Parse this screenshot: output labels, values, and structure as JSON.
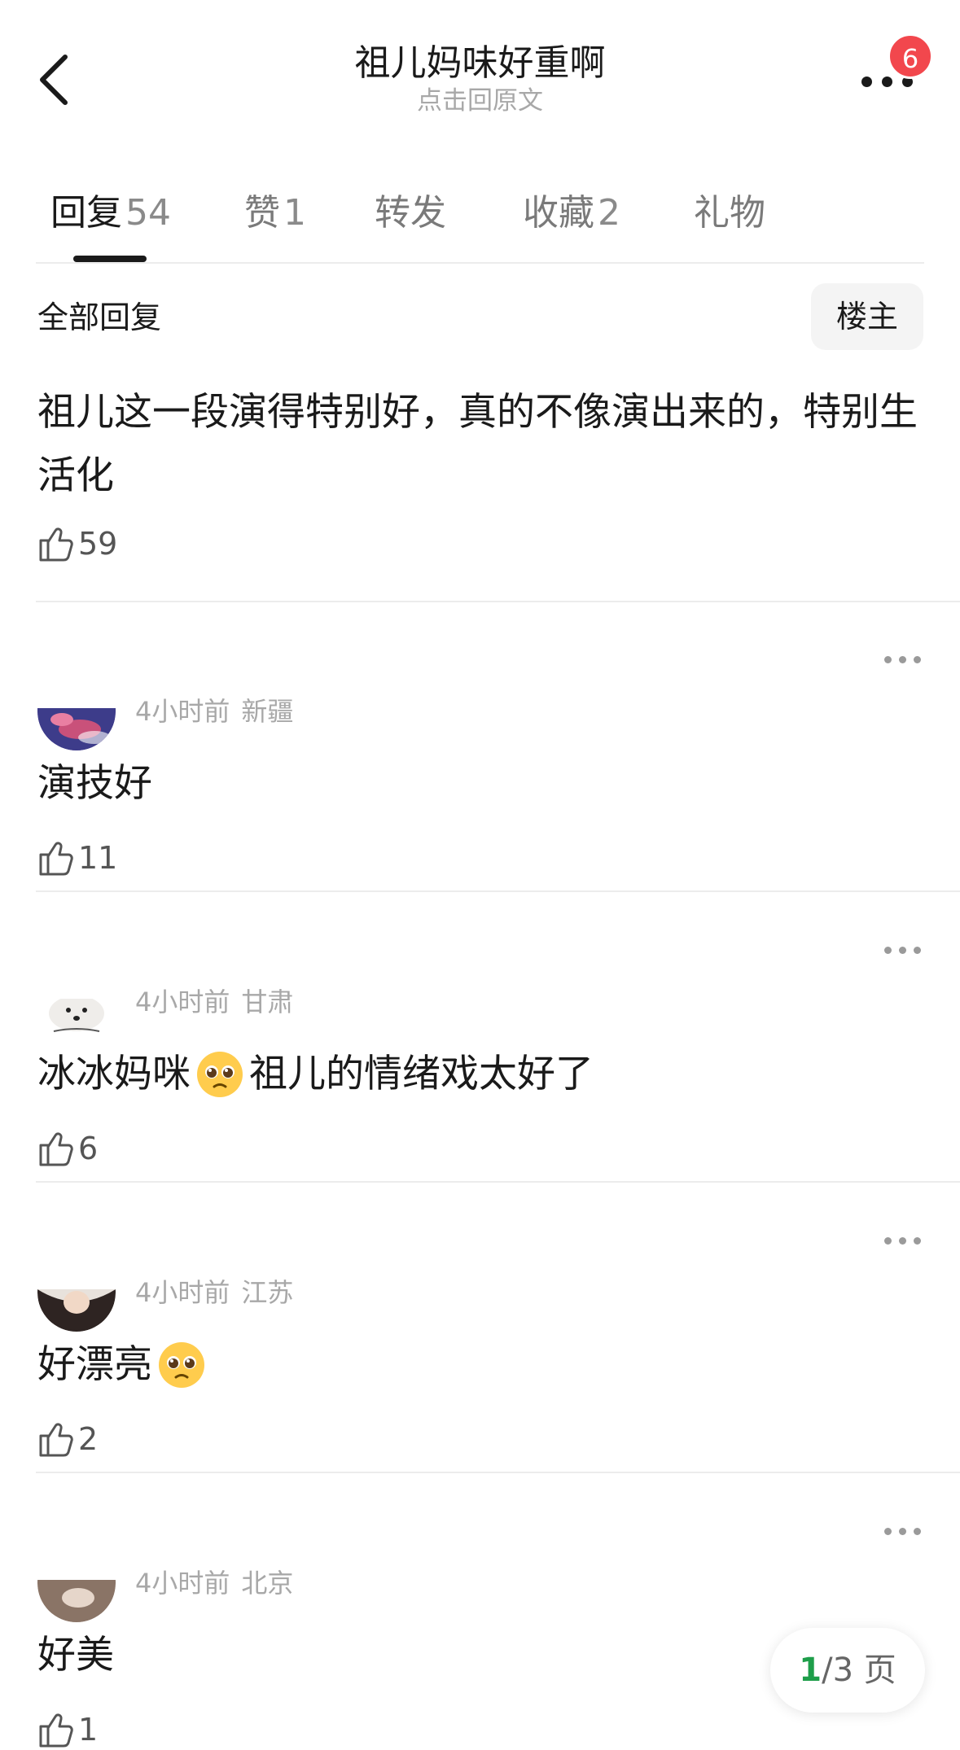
{
  "header": {
    "title": "祖儿妈味好重啊",
    "subtitle": "点击回原文",
    "notification_count": "6"
  },
  "tabs": [
    {
      "label": "回复",
      "count": "54"
    },
    {
      "label": "赞",
      "count": "1"
    },
    {
      "label": "转发",
      "count": ""
    },
    {
      "label": "收藏",
      "count": "2"
    },
    {
      "label": "礼物",
      "count": ""
    }
  ],
  "filter": {
    "all_replies_label": "全部回复",
    "op_only_label": "楼主"
  },
  "main_post": {
    "text": "祖儿这一段演得特别好，真的不像演出来的，特别生活化",
    "likes": "59"
  },
  "comments": [
    {
      "time": "4小时前",
      "location": "新疆",
      "text": "演技好",
      "emoji_after": "",
      "text_after": "",
      "likes": "11",
      "avatar_color": "#6b4fa3"
    },
    {
      "time": "4小时前",
      "location": "甘肃",
      "text": "冰冰妈咪",
      "emoji_after": "pleading-face",
      "text_after": "祖儿的情绪戏太好了",
      "likes": "6",
      "avatar_color": "#e8e6e3"
    },
    {
      "time": "4小时前",
      "location": "江苏",
      "text": "好漂亮",
      "emoji_after": "pleading-face",
      "text_after": "",
      "likes": "2",
      "avatar_color": "#3a2c2a"
    },
    {
      "time": "4小时前",
      "location": "北京",
      "text": "好美",
      "emoji_after": "",
      "text_after": "",
      "likes": "1",
      "avatar_color": "#9b8676"
    }
  ],
  "pager": {
    "current": "1",
    "total_text": "/3 页"
  },
  "colors": {
    "badge": "#f2474d",
    "pager_current": "#1e9e4a",
    "muted_text": "#a8a8a8"
  }
}
